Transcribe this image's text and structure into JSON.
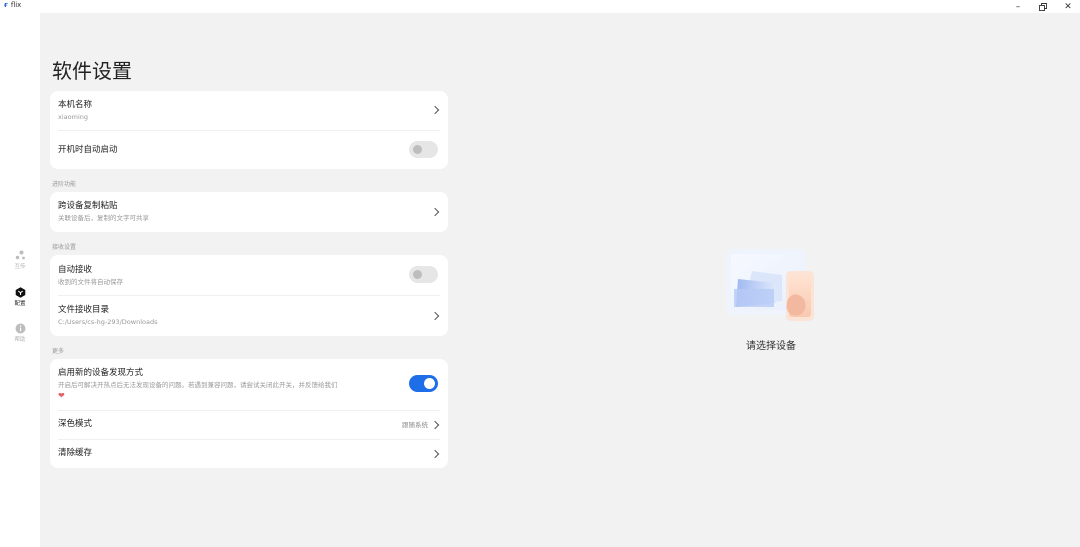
{
  "app": {
    "title": "flix",
    "logo_icon": "flix-logo-icon"
  },
  "window_controls": {
    "minimize": "–",
    "restore": "🗗",
    "close": "✕"
  },
  "sidebar": {
    "items": [
      {
        "label": "互传",
        "icon": "share-dots-icon",
        "active": false
      },
      {
        "label": "配置",
        "icon": "settings-hex-icon",
        "active": true
      },
      {
        "label": "帮助",
        "icon": "info-icon",
        "active": false
      }
    ]
  },
  "page": {
    "title": "软件设置"
  },
  "basic": {
    "device_name_title": "本机名称",
    "device_name_value": "xiaoming",
    "autostart_title": "开机时自动启动",
    "autostart_on": false
  },
  "advanced": {
    "section_label": "进阶功能",
    "clipboard_title": "跨设备复制粘贴",
    "clipboard_sub": "关联设备后，复制的文字可共享"
  },
  "receive": {
    "section_label": "接收设置",
    "auto_receive_title": "自动接收",
    "auto_receive_sub": "收到的文件将自动保存",
    "auto_receive_on": false,
    "dir_title": "文件接收目录",
    "dir_value": "C:/Users/cs-hg-293/Downloads"
  },
  "more": {
    "section_label": "更多",
    "discovery_title": "启用新的设备发现方式",
    "discovery_sub": "开启后可解决开热点后无法发现设备的问题。若遇到兼容问题，请尝试关闭此开关，并反馈给我们",
    "discovery_on": true,
    "dark_mode_title": "深色模式",
    "dark_mode_value": "跟随系统",
    "clear_cache_title": "清除缓存"
  },
  "empty_state": {
    "text": "请选择设备",
    "illustration": "device-select-illustration"
  },
  "colors": {
    "accent": "#1e6ee8",
    "background": "#f2f2f2",
    "card": "#ffffff",
    "heart": "#e0606a"
  }
}
